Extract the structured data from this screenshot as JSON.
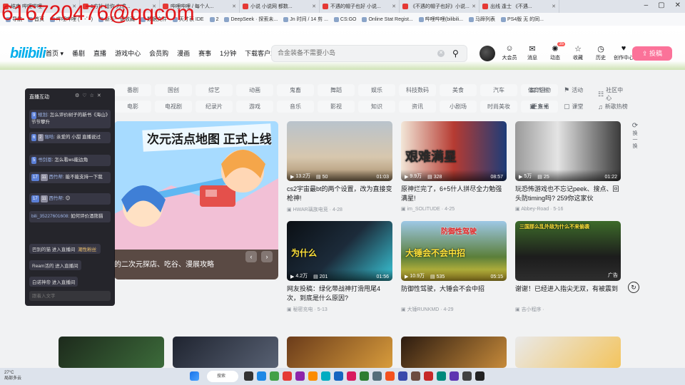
{
  "watermark": "616720476@qqcom",
  "tabs": [
    {
      "label": "结束 哔哩哔哩",
      "active": false
    },
    {
      "label": "1方针 给你 力求..."
    },
    {
      "label": "哔哩哔哩 / 每个人..."
    },
    {
      "label": "小说 小说网 都数..."
    },
    {
      "label": "不遇的帽子也好 小说..."
    },
    {
      "label": "《不遇的帽子也好》小说..."
    },
    {
      "label": "出线 逢士 《不遇..."
    }
  ],
  "bookmarks": [
    "导航",
    "首页",
    "哔哩哔哩 (゜-゜)",
    "新手一键收藏",
    "数据文件",
    "天才表 IDE",
    "2",
    "DeepSeek · 探索未...",
    "Jn 时间 / 14 剪 ...",
    "CS:GO",
    "Online Stat Regist...",
    "哔哩哔哩(bilibili...",
    "马蹄列表",
    "PS4版 无 的同..."
  ],
  "header": {
    "logo": "bilibili",
    "nav": [
      "首页 ▾",
      "番剧",
      "直播",
      "游戏中心",
      "会员购",
      "漫画",
      "赛事",
      "1分钟",
      "下载客户端"
    ],
    "search_placeholder": "合金装备不需要小岛",
    "user_menu": [
      {
        "icon": "vip-icon",
        "glyph": "☺",
        "label": "大会员"
      },
      {
        "icon": "message-icon",
        "glyph": "✉",
        "label": "消息"
      },
      {
        "icon": "dynamic-icon",
        "glyph": "✺",
        "label": "动态",
        "badge": "35"
      },
      {
        "icon": "favorite-icon",
        "glyph": "☆",
        "label": "收藏"
      },
      {
        "icon": "history-icon",
        "glyph": "◷",
        "label": "历史"
      },
      {
        "icon": "creator-icon",
        "glyph": "♥",
        "label": "创作中心"
      }
    ],
    "upload_label": "⇪ 投稿"
  },
  "categories": {
    "row1": [
      "番剧",
      "国创",
      "综艺",
      "动画",
      "鬼畜",
      "舞蹈",
      "娱乐",
      "科技数码",
      "美食",
      "汽车",
      "体育运动"
    ],
    "row2": [
      "电影",
      "电视剧",
      "纪录片",
      "游戏",
      "音乐",
      "影视",
      "知识",
      "资讯",
      "小剧场",
      "时尚美妆",
      "更多 ▾"
    ],
    "right": [
      {
        "icon": "column-icon",
        "glyph": "▤",
        "label": "专栏"
      },
      {
        "icon": "activity-icon",
        "glyph": "⚑",
        "label": "活动"
      },
      {
        "icon": "community-icon",
        "glyph": "☷",
        "label": "社区中心"
      },
      {
        "icon": "live-icon",
        "glyph": "▣",
        "label": "直播"
      },
      {
        "icon": "classroom-icon",
        "glyph": "▢",
        "label": "课堂"
      },
      {
        "icon": "music-icon",
        "glyph": "♫",
        "label": "新歌热榜"
      }
    ]
  },
  "carousel": {
    "banner_text": "次元活点地图 正式上线",
    "caption": "的二次元探店、吃谷、漫展攻略",
    "prev": "‹",
    "next": "›"
  },
  "videos": [
    {
      "views": "13.2万",
      "danmaku": "50",
      "duration": "01:03",
      "title": "cs2宇宙最bt的两个设置，改为直接变枪神!",
      "author": "HWAR璃族电竞",
      "date": "4-28"
    },
    {
      "views": "9.9万",
      "danmaku": "328",
      "duration": "08:57",
      "title": "原神烂完了，6+5什人拼尽全力勉强满星!",
      "author": "im_SOLITUDE",
      "date": "4-25",
      "overlay": "艰难满星"
    },
    {
      "views": "5万",
      "danmaku": "25",
      "duration": "01:22",
      "title": "玩恐怖游戏也不忘记peek、搜点、回头防timing吗? 259你这家伙",
      "author": "Abbey-Road",
      "date": "5-16"
    },
    {
      "views": "4.2万",
      "danmaku": "201",
      "duration": "01:56",
      "title": "网友投稿：绿化带战神打滑甩尾4次，到底是什么原因?",
      "author": "秘密充电",
      "date": "5-13",
      "overlay": "为什么"
    },
    {
      "views": "10.9万",
      "danmaku": "535",
      "duration": "05:15",
      "title": "防御性驾驶，大锤会不会中招",
      "author": "大锤RUNKMD",
      "date": "4-29",
      "overlay": "大锤会不会中招",
      "overlay2": "防御性驾驶"
    },
    {
      "views": "",
      "danmaku": "",
      "duration": "",
      "title": "谢谢！已经进入指尖无双，有被震到",
      "author": "吉小程序",
      "date": "",
      "ad": "广告",
      "overlay": "三国那么乱外敌为什么不来偷袭"
    }
  ],
  "refresh_label": "换一换",
  "chat": {
    "title": "直播互动",
    "tools": [
      "⚙",
      "♡",
      "☆",
      "✕"
    ],
    "messages": [
      {
        "level": "9",
        "user": "规划",
        "text": "怎么评价树子的新书《海山》节节攀升"
      },
      {
        "level": "6",
        "medal": "2",
        "user": "猴哈",
        "text": "亲爱的 小甜 直播说过"
      },
      {
        "level": "5",
        "user": "书剑恩",
        "text": "怎么看ws能边角"
      },
      {
        "level": "17",
        "medal": "11",
        "user": "西竹帮",
        "text": "能不能支持一下我"
      },
      {
        "level": "17",
        "medal": "11",
        "user": "西竹帮",
        "text": "😊"
      },
      {
        "level": "",
        "user": "bili_35227601608",
        "text": "如何评价酒熊猫"
      }
    ],
    "entries": [
      {
        "text": "巴别的猫 进入直播间",
        "tag": "潮性粉丝"
      },
      {
        "text": "Ream活的 进入直播间"
      },
      {
        "text": "白诺神帝 进入直播间"
      }
    ],
    "input_placeholder": "跟着入文字"
  },
  "taskbar": {
    "temp": "27°C",
    "weather": "局部多云",
    "search": "搜索"
  },
  "colors": {
    "brand_blue": "#00aeec",
    "brand_pink": "#fb7299"
  }
}
